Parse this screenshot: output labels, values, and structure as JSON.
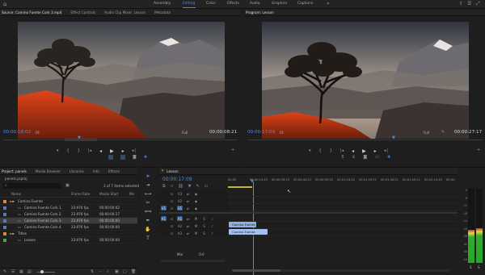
{
  "workspaces": [
    {
      "label": "Assembly",
      "active": false
    },
    {
      "label": "Editing",
      "active": true
    },
    {
      "label": "Color",
      "active": false
    },
    {
      "label": "Effects",
      "active": false
    },
    {
      "label": "Audio",
      "active": false
    },
    {
      "label": "Graphics",
      "active": false
    },
    {
      "label": "Captions",
      "active": false
    }
  ],
  "source_monitor": {
    "tabs": [
      "Source: Camino Fuente Cork 3.mp4",
      "Effect Controls",
      "Audio Clip Mixer: Lesson",
      "Metadata"
    ],
    "timecode_in": "00:00:18:02",
    "fit": "Fit",
    "quality": "Full",
    "timecode_dur": "00:00:08:21"
  },
  "program_monitor": {
    "tab": "Program: Lesson",
    "timecode_in": "00:00:17:09",
    "fit": "Fit",
    "quality": "Full",
    "timecode_dur": "00:00:27:17"
  },
  "project_panel": {
    "tabs": [
      "Project: panels",
      "Media Browser",
      "Libraries",
      "Info",
      "Effects"
    ],
    "file": "panels.prproj",
    "count": "1 of 7 items selected",
    "columns": [
      "Name",
      "Frame Rate",
      "Media Start",
      "Me"
    ],
    "rows": [
      {
        "name": "Camino Fuente",
        "rate": "",
        "start": "",
        "folder": true,
        "color": "#d78a3a",
        "selected": false
      },
      {
        "name": "Camino Fuente Cork 1.",
        "rate": "23.976 fps",
        "start": "00:00:00:02",
        "folder": false,
        "color": "#5b79b8",
        "selected": false
      },
      {
        "name": "Camino Fuente Cork 2.",
        "rate": "23.976 fps",
        "start": "00:00:00:17",
        "folder": false,
        "color": "#5b79b8",
        "selected": false
      },
      {
        "name": "Camino Fuente Cork 3.",
        "rate": "23.976 fps",
        "start": "00:00:00:00",
        "folder": false,
        "color": "#5b79b8",
        "selected": true
      },
      {
        "name": "Camino Fuente Cork 4.",
        "rate": "23.976 fps",
        "start": "00:00:00:00",
        "folder": false,
        "color": "#5b79b8",
        "selected": false
      },
      {
        "name": "Titles",
        "rate": "",
        "start": "",
        "folder": true,
        "color": "#d78a3a",
        "selected": false
      },
      {
        "name": "Lesson",
        "rate": "23.976 fps",
        "start": "00:00:00:00",
        "folder": false,
        "color": "#4ea24e",
        "selected": false
      }
    ]
  },
  "timeline": {
    "tab": "Lesson",
    "timecode": "00:00:17:09",
    "ruler": [
      "00:00",
      "00:00:14:23",
      "00:00:29:23",
      "00:00:44:22",
      "00:00:59:22",
      "00:01:14:22",
      "00:01:29:21",
      "00:01:44:21",
      "00:01:59:21",
      "00:02:14:20",
      "00:02:"
    ],
    "tracks": [
      "V3",
      "V2",
      "V1",
      "A1",
      "A2",
      "A3"
    ],
    "src_v": "V1",
    "src_a": "A1",
    "mix_label": "Mix",
    "mix_value": "0.0",
    "clip_video": "Camino Fuente",
    "clip_audio": "Camino Fuente"
  },
  "meter": {
    "scale": [
      "0",
      "-6",
      "-12",
      "-18",
      "-24",
      "-30",
      "-36",
      "-42",
      "-48",
      "-54"
    ],
    "labels": [
      "S",
      "S"
    ],
    "level_left": 0.45,
    "level_right": 0.47
  },
  "colors": {
    "accent": "#4a8fe0",
    "clip_video": "#8fb0e0",
    "clip_audio": "#a6c1ee"
  }
}
